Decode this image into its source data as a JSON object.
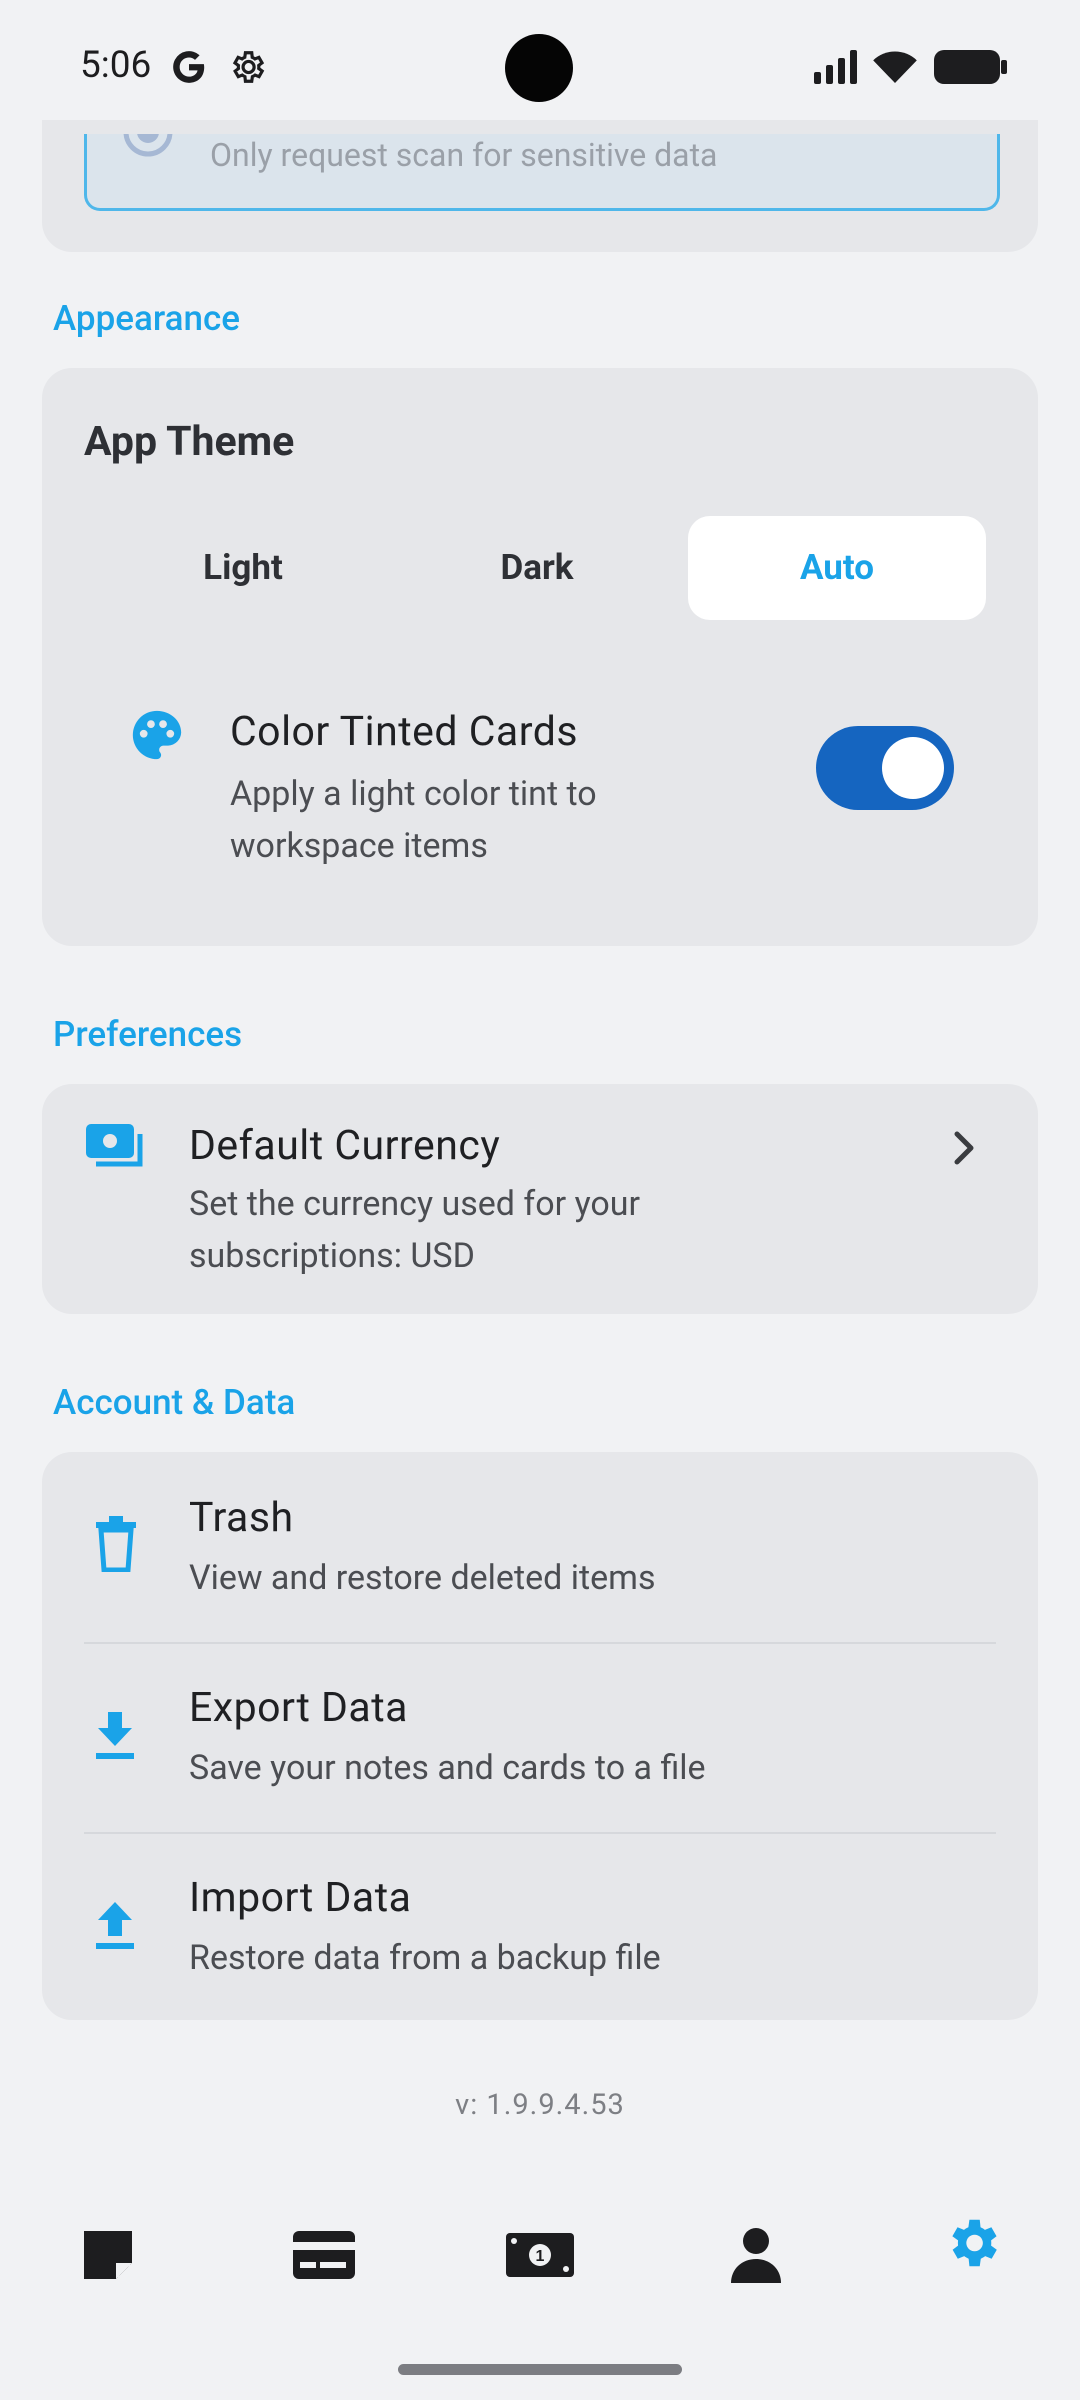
{
  "status_bar": {
    "time": "5:06"
  },
  "scan_option": {
    "text": "Only request scan for sensitive data"
  },
  "appearance": {
    "section_title": "Appearance",
    "app_theme": {
      "title": "App Theme",
      "options": [
        "Light",
        "Dark",
        "Auto"
      ],
      "selected": "Auto"
    },
    "color_tinted": {
      "title": "Color Tinted Cards",
      "desc_line1": "Apply a light color tint to",
      "desc_line2": "workspace items",
      "enabled": true
    }
  },
  "preferences": {
    "section_title": "Preferences",
    "default_currency": {
      "title": "Default Currency",
      "desc_line1": "Set the currency used for your",
      "desc_line2": "subscriptions: USD"
    }
  },
  "account_data": {
    "section_title": "Account & Data",
    "items": [
      {
        "title": "Trash",
        "desc": "View and restore deleted items"
      },
      {
        "title": "Export Data",
        "desc": "Save your notes and cards to a file"
      },
      {
        "title": "Import Data",
        "desc": "Restore data from a backup file"
      }
    ]
  },
  "version": "v: 1.9.9.4.53",
  "colors": {
    "accent": "#1aa3e8",
    "toggle": "#1565c0",
    "card": "#e6e7ea",
    "background": "#f1f2f4"
  },
  "bottom_nav": [
    "notes-icon",
    "card-icon",
    "money-icon",
    "person-icon",
    "settings-icon"
  ],
  "bottom_nav_active": "settings-icon"
}
